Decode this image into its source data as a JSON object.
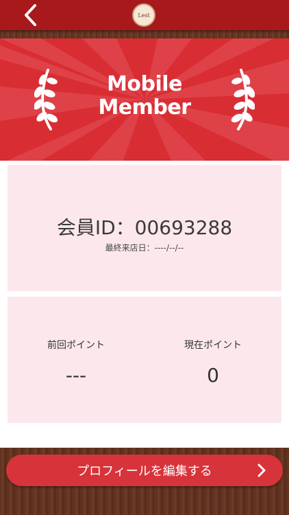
{
  "header": {
    "logo_text": "Lest",
    "back_icon": "chevron-left-icon"
  },
  "banner": {
    "title_line1": "Mobile",
    "title_line2": "Member",
    "laurel_icon": "laurel-icon"
  },
  "member": {
    "id_label": "会員ID：00693288",
    "last_visit": "最終来店日：----/--/--"
  },
  "points": {
    "previous_label": "前回ポイント",
    "previous_value": "---",
    "current_label": "現在ポイント",
    "current_value": "0"
  },
  "actions": {
    "edit_profile_label": "プロフィールを編集する",
    "chevron_icon": "chevron-right-icon"
  },
  "colors": {
    "header": "#a7191b",
    "banner": "#d92d34",
    "card": "#fce8ec",
    "button": "#d7333a"
  }
}
